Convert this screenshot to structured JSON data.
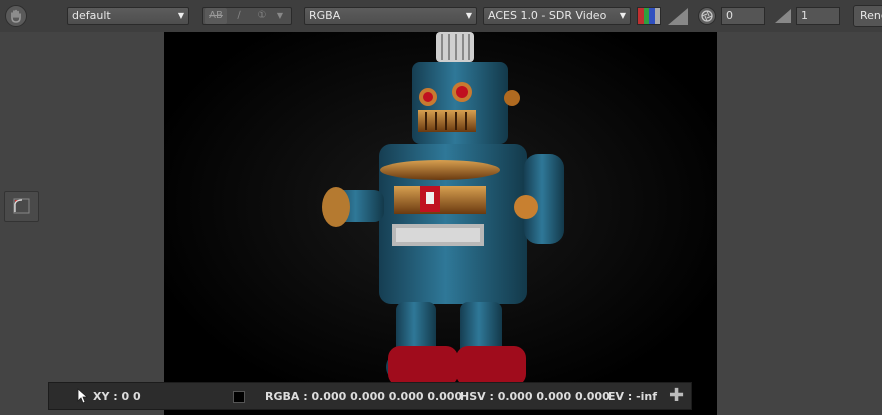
{
  "toolbar": {
    "layer_select": "default",
    "ab_label": "AB",
    "channel_select": "RGBA",
    "view_transform": "ACES 1.0 - SDR Video",
    "exposure_value": "0",
    "gamma_value": "1",
    "render_label": "Rend"
  },
  "status": {
    "xy": "XY : 0 0",
    "rgba": "RGBA : 0.000 0.000 0.000 0.000",
    "hsv": "HSV : 0.000 0.000 0.000",
    "ev": "EV : -inf"
  },
  "colors": {
    "swatch_red": "#c03030",
    "swatch_green": "#30a040",
    "swatch_blue": "#3050c0",
    "robot_blue": "#2a6a88",
    "robot_red": "#b01020"
  }
}
